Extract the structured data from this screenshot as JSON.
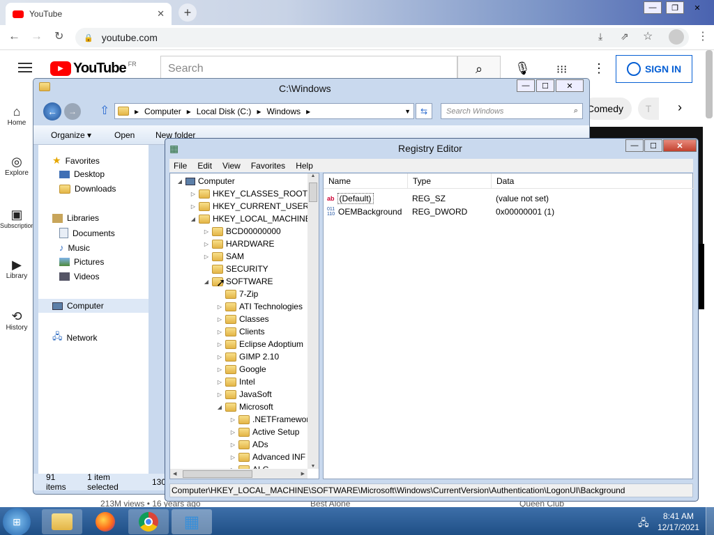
{
  "chrome": {
    "tab_title": "YouTube",
    "url": "youtube.com"
  },
  "youtube": {
    "logo_text": "YouTube",
    "logo_region": "FR",
    "search_placeholder": "Search",
    "signin_label": "SIGN IN",
    "chip_comedy": "Comedy",
    "chip_partial": "T",
    "sidebar": [
      {
        "label": "Home",
        "icon": "home-icon"
      },
      {
        "label": "Explore",
        "icon": "compass-icon"
      },
      {
        "label": "Subscriptions",
        "icon": "subscriptions-icon"
      },
      {
        "label": "Library",
        "icon": "library-icon"
      },
      {
        "label": "History",
        "icon": "history-icon"
      }
    ],
    "bottom_views": "213M views • 16 years ago",
    "bottom_title1": "Best Alone",
    "bottom_title2": "Queen Club"
  },
  "explorer": {
    "title": "C:\\Windows",
    "breadcrumb": [
      "Computer",
      "Local Disk (C:)",
      "Windows"
    ],
    "search_placeholder": "Search Windows",
    "toolbar": {
      "organize": "Organize",
      "open": "Open",
      "new_folder": "New folder"
    },
    "nav": {
      "favorites": "Favorites",
      "desktop": "Desktop",
      "downloads": "Downloads",
      "libraries": "Libraries",
      "documents": "Documents",
      "music": "Music",
      "pictures": "Pictures",
      "videos": "Videos",
      "computer": "Computer",
      "network": "Network"
    },
    "status_items": "91 items",
    "status_selected": "1 item selected",
    "status_size": "130"
  },
  "regedit": {
    "title": "Registry Editor",
    "menu": [
      "File",
      "Edit",
      "View",
      "Favorites",
      "Help"
    ],
    "tree": [
      {
        "label": "Computer",
        "level": 0,
        "tw": "◢"
      },
      {
        "label": "HKEY_CLASSES_ROOT",
        "level": 1,
        "tw": "▷"
      },
      {
        "label": "HKEY_CURRENT_USER",
        "level": 1,
        "tw": "▷"
      },
      {
        "label": "HKEY_LOCAL_MACHINE",
        "level": 1,
        "tw": "◢"
      },
      {
        "label": "BCD00000000",
        "level": 2,
        "tw": "▷"
      },
      {
        "label": "HARDWARE",
        "level": 2,
        "tw": "▷"
      },
      {
        "label": "SAM",
        "level": 2,
        "tw": "▷"
      },
      {
        "label": "SECURITY",
        "level": 2,
        "tw": ""
      },
      {
        "label": "SOFTWARE",
        "level": 2,
        "tw": "◢"
      },
      {
        "label": "7-Zip",
        "level": 3,
        "tw": ""
      },
      {
        "label": "ATI Technologies",
        "level": 3,
        "tw": "▷"
      },
      {
        "label": "Classes",
        "level": 3,
        "tw": "▷"
      },
      {
        "label": "Clients",
        "level": 3,
        "tw": "▷"
      },
      {
        "label": "Eclipse Adoptium",
        "level": 3,
        "tw": "▷"
      },
      {
        "label": "GIMP 2.10",
        "level": 3,
        "tw": "▷"
      },
      {
        "label": "Google",
        "level": 3,
        "tw": "▷"
      },
      {
        "label": "Intel",
        "level": 3,
        "tw": "▷"
      },
      {
        "label": "JavaSoft",
        "level": 3,
        "tw": "▷"
      },
      {
        "label": "Microsoft",
        "level": 3,
        "tw": "◢"
      },
      {
        "label": ".NETFramewor",
        "level": 4,
        "tw": "▷"
      },
      {
        "label": "Active Setup",
        "level": 4,
        "tw": "▷"
      },
      {
        "label": "ADs",
        "level": 4,
        "tw": "▷"
      },
      {
        "label": "Advanced INF",
        "level": 4,
        "tw": "▷"
      },
      {
        "label": "ALG",
        "level": 4,
        "tw": "▷"
      }
    ],
    "columns": {
      "name": "Name",
      "type": "Type",
      "data": "Data"
    },
    "values": [
      {
        "name": "(Default)",
        "type": "REG_SZ",
        "data": "(value not set)",
        "icon": "string-value-icon"
      },
      {
        "name": "OEMBackground",
        "type": "REG_DWORD",
        "data": "0x00000001 (1)",
        "icon": "binary-value-icon"
      }
    ],
    "status_path": "Computer\\HKEY_LOCAL_MACHINE\\SOFTWARE\\Microsoft\\Windows\\CurrentVersion\\Authentication\\LogonUI\\Background"
  },
  "taskbar": {
    "time": "8:41 AM",
    "date": "12/17/2021"
  },
  "colors": {
    "youtube_red": "#ff0000",
    "signin_blue": "#065fd4",
    "taskbar": "#2a5a95"
  }
}
